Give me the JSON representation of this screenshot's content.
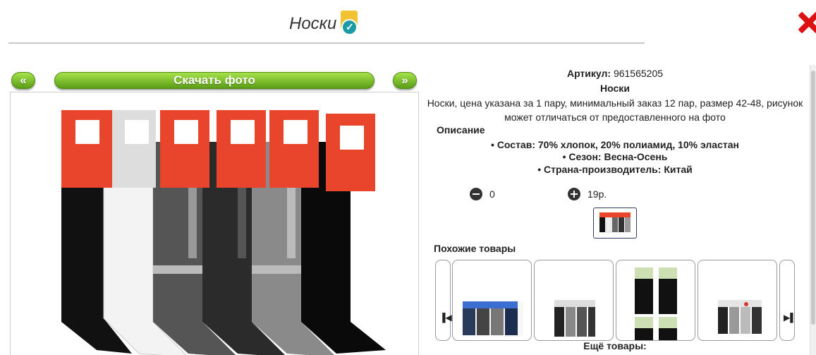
{
  "header": {
    "title": "Носки",
    "badge_icon": "verified-check-icon"
  },
  "nav": {
    "prev_label": "«",
    "next_label": "»",
    "download_label": "Скачать фото"
  },
  "product": {
    "article_label": "Артикул:",
    "article_value": "961565205",
    "name": "Носки",
    "description": "Носки, цена указана за 1 пару, минимальный заказ 12 пар, размер 42-48, рисунок может отличаться от предоставленного на фото",
    "description_title": "Описание",
    "bullets": [
      "Состав: 70% хлопок, 20% полиамид, 10% эластан",
      "Сезон: Весна-Осень",
      "Страна-производитель: Китай"
    ],
    "quantity": "0",
    "price": "19р."
  },
  "similar": {
    "title": "Похожие товары",
    "more_label": "Ещё товары:"
  },
  "colors": {
    "accent_green": "#5a9d15",
    "close_red": "#dd1111",
    "badge_yellow": "#f1c232",
    "badge_teal": "#1a9ba6"
  }
}
